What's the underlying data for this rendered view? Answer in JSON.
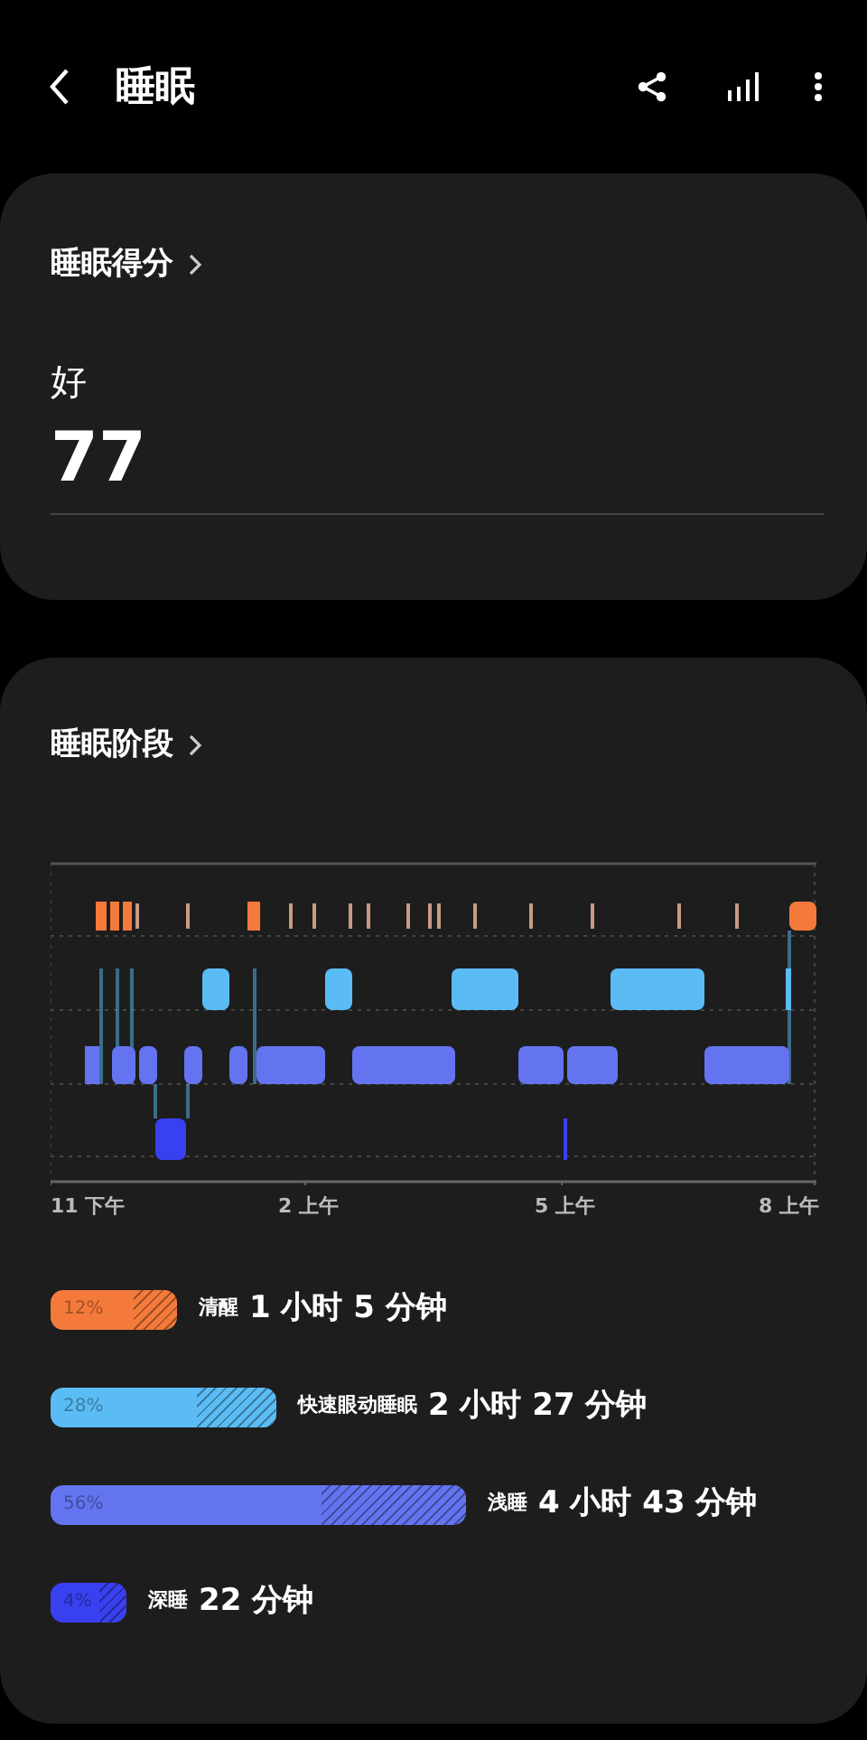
{
  "header": {
    "title": "睡眠"
  },
  "score_card": {
    "title": "睡眠得分",
    "rating": "好",
    "score": "77"
  },
  "stages_card": {
    "title": "睡眠阶段",
    "axis_labels": [
      "11 下午",
      "2 上午",
      "5 上午",
      "8 上午"
    ],
    "stages": [
      {
        "percent": "12%",
        "name": "清醒",
        "duration": "1 小时 5 分钟",
        "color": "#f47a3c"
      },
      {
        "percent": "28%",
        "name": "快速眼动睡眠",
        "duration": "2 小时 27 分钟",
        "color": "#5bbcf5"
      },
      {
        "percent": "56%",
        "name": "浅睡",
        "duration": "4 小时 43 分钟",
        "color": "#6474f0"
      },
      {
        "percent": "4%",
        "name": "深睡",
        "duration": "22 分钟",
        "color": "#3940f0"
      }
    ]
  }
}
